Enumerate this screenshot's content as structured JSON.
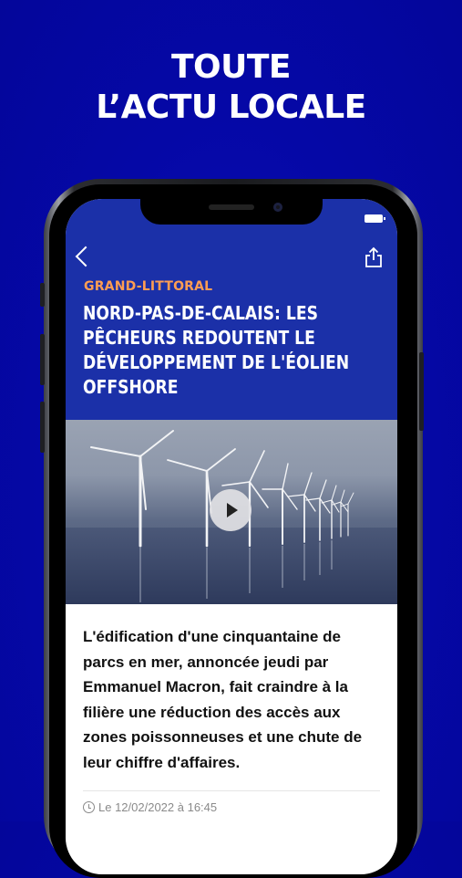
{
  "promo": {
    "headline_line1": "TOUTE",
    "headline_line2": "L’ACTU LOCALE"
  },
  "article": {
    "category": "GRAND-LITTORAL",
    "title": "NORD-PAS-DE-CALAIS: LES PÊCHEURS REDOUTENT LE DÉVELOPPEMENT DE L'ÉOLIEN OFFSHORE",
    "lede": "L'édification d'une cinquantaine de parcs en mer, annoncée jeudi par Emmanuel Macron, fait craindre à la filière une réduction des accès aux zones poissonneuses et une chute de leur chiffre d'affaires.",
    "date": "Le 12/02/2022 à 16:45",
    "media_icon": "play-icon"
  },
  "colors": {
    "background": "#0508a6",
    "header": "#1b30a8",
    "category": "#ff9d52"
  }
}
